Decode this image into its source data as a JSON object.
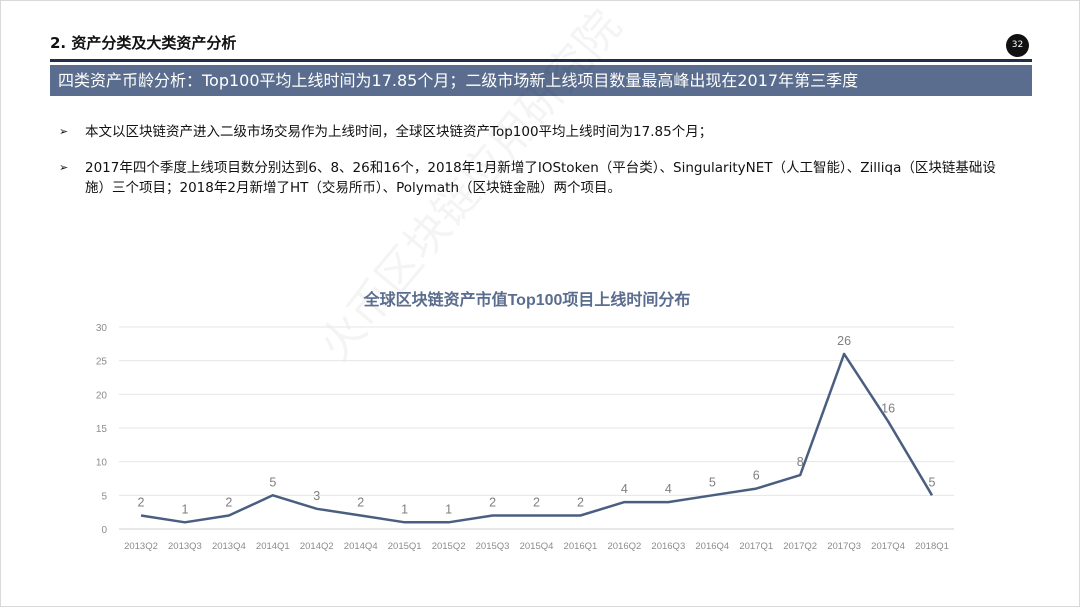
{
  "header": {
    "section_title": "2. 资产分类及大类资产分析",
    "page_number": "32",
    "banner": "四类资产币龄分析：Top100平均上线时间为17.85个月；二级市场新上线项目数量最高峰出现在2017年第三季度"
  },
  "bullets": [
    "本文以区块链资产进入二级市场交易作为上线时间，全球区块链资产Top100平均上线时间为17.85个月；",
    "2017年四个季度上线项目数分别达到6、8、26和16个，2018年1月新增了IOStoken（平台类）、SingularityNET（人工智能）、Zilliqa（区块链基础设施）三个项目；2018年2月新增了HT（交易所币）、Polymath（区块链金融）两个项目。"
  ],
  "watermark": "火币区块链应用研究院",
  "colors": {
    "banner": "#5a6d8e",
    "line": "#4a5f80",
    "title": "#5a6d8e",
    "rule": "#1f2f4a"
  },
  "chart_data": {
    "type": "line",
    "title": "全球区块链资产市值Top100项目上线时间分布",
    "categories": [
      "2013Q2",
      "2013Q3",
      "2013Q4",
      "2014Q1",
      "2014Q2",
      "2014Q4",
      "2015Q1",
      "2015Q2",
      "2015Q3",
      "2015Q4",
      "2016Q1",
      "2016Q2",
      "2016Q3",
      "2016Q4",
      "2017Q1",
      "2017Q2",
      "2017Q3",
      "2017Q4",
      "2018Q1"
    ],
    "values": [
      2,
      1,
      2,
      5,
      3,
      2,
      1,
      1,
      2,
      2,
      2,
      4,
      4,
      5,
      6,
      8,
      26,
      16,
      5
    ],
    "yticks": [
      0,
      5,
      10,
      15,
      20,
      25,
      30
    ],
    "ylim": [
      0,
      30
    ],
    "grid": true,
    "legend": "none"
  }
}
